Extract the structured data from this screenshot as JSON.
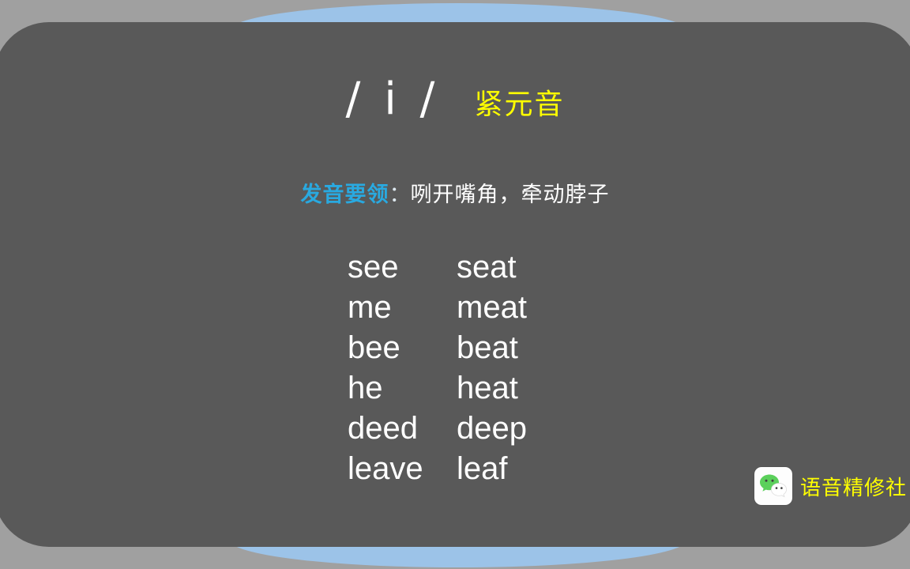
{
  "slide": {
    "background_color": "#a0a0a0",
    "panel_color": "#595959",
    "accent_blue": "#9cc3e8"
  },
  "title": {
    "phoneme": "/ i /",
    "category": "紧元音",
    "category_color": "#ffff00",
    "phoneme_color": "#ffffff"
  },
  "tip": {
    "label": "发音要领",
    "label_color": "#29a9e0",
    "colon": "：",
    "text": "咧开嘴角，牵动脖子",
    "text_color": "#ffffff"
  },
  "words": {
    "rows": [
      {
        "left": "see",
        "right": "seat"
      },
      {
        "left": "me",
        "right": "meat"
      },
      {
        "left": "bee",
        "right": "beat"
      },
      {
        "left": "he",
        "right": "heat"
      },
      {
        "left": "deed",
        "right": "deep"
      },
      {
        "left": "leave",
        "right": "leaf"
      }
    ]
  },
  "watermark": {
    "icon": "wechat-icon",
    "text": "语音精修社",
    "text_color": "#ffff00"
  }
}
